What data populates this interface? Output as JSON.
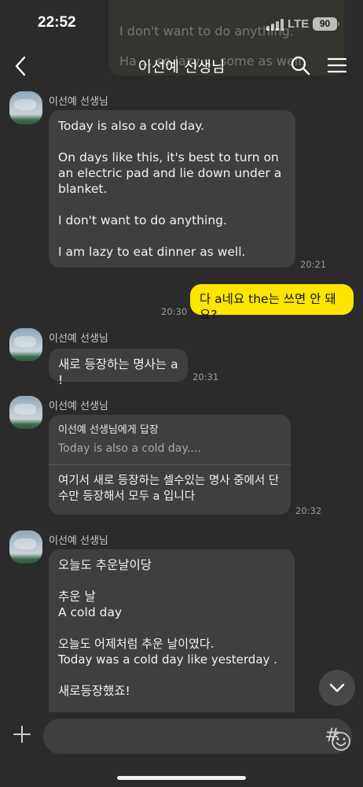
{
  "status": {
    "time": "22:52",
    "network": "LTE",
    "battery": "90"
  },
  "ghost_preview": {
    "line1": "I don't want to do anything.",
    "line2": "Ha ... so lazy ... some as well."
  },
  "header": {
    "title": "이선예 선생님"
  },
  "messages": [
    {
      "sender": "이선예 선생님",
      "lines": [
        "Today is also a cold day.",
        "On days like this, it's best to turn on an electric pad and lie down under a blanket.",
        "I don't want to do anything.",
        "I am lazy to eat dinner as well."
      ],
      "time": "20:21"
    },
    {
      "mine": true,
      "text": "다 a네요 the는 쓰면 안 돼요?",
      "time": "20:30"
    },
    {
      "sender": "이선예 선생님",
      "text": "새로 등장하는 명사는 a !",
      "time": "20:31"
    },
    {
      "sender": "이선예 선생님",
      "reply_to": "이선예 선생님에게 답장",
      "reply_preview": "Today is also a cold day.…",
      "text": "여기서 새로 등장하는 셀수있는 명사 중에서 단수만 등장해서 모두 a 입니다",
      "time": "20:32"
    },
    {
      "sender": "이선예 선생님",
      "lines": [
        "오늘도 추운날이당",
        "추운 날\nA cold day",
        "오늘도 어제처럼 추운 날이였다.\nToday was a cold day like yesterday .",
        "새로등장했죠!"
      ]
    }
  ],
  "icons": {
    "back": "chevron-left-icon",
    "search": "search-icon",
    "menu": "hamburger-menu-icon",
    "scroll": "chevron-down-icon",
    "plus": "plus-icon",
    "emoji": "emoji-icon",
    "hash": "#"
  }
}
